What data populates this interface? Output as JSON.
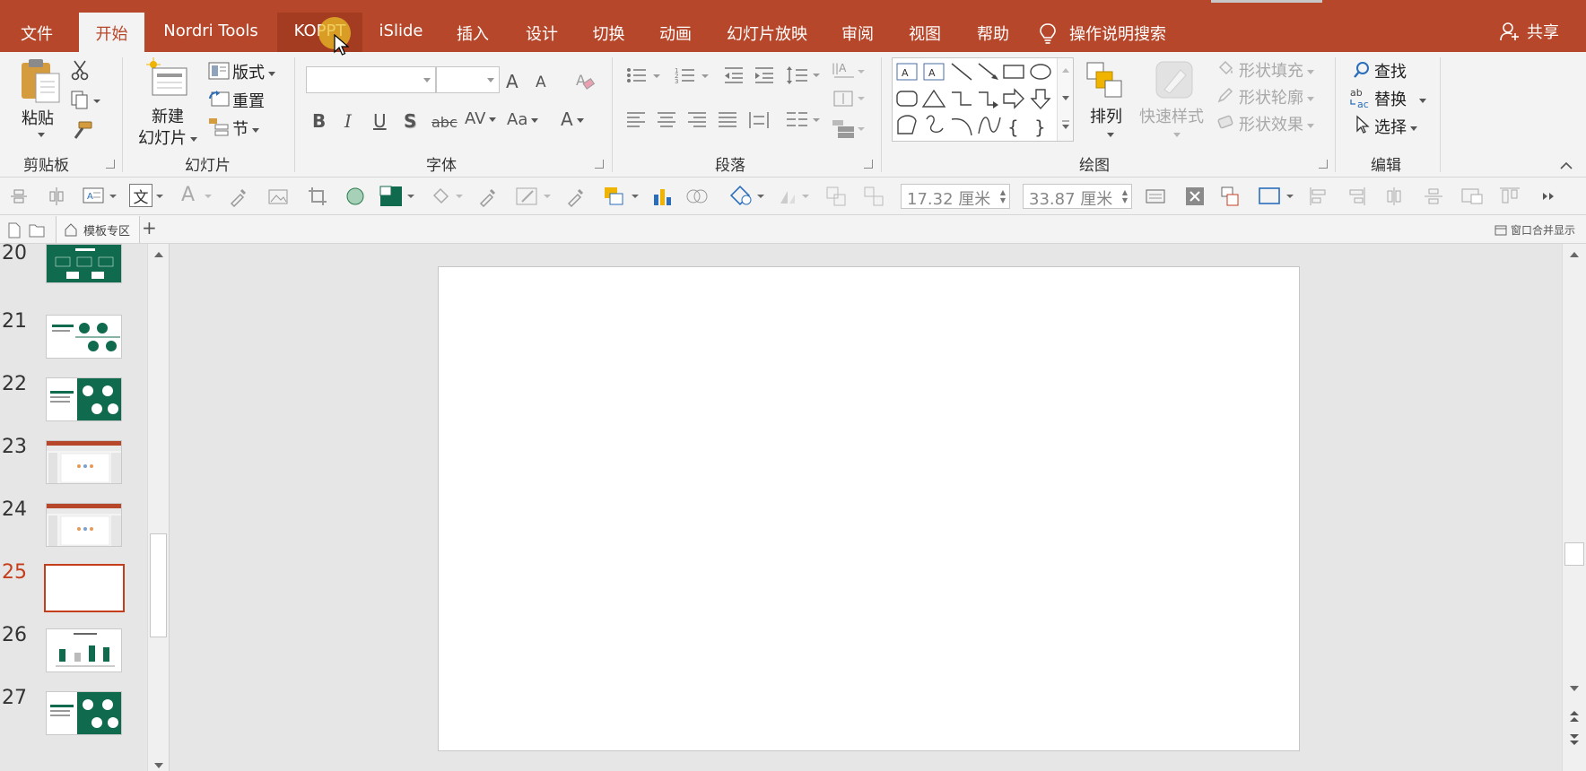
{
  "tabs": {
    "file": "文件",
    "home": "开始",
    "nordri": "Nordri Tools",
    "koppt": "KOPPT",
    "islide": "iSlide",
    "insert": "插入",
    "design": "设计",
    "transitions": "切换",
    "animations": "动画",
    "slideshow": "幻灯片放映",
    "review": "审阅",
    "view": "视图",
    "help": "帮助"
  },
  "tell_me": "操作说明搜索",
  "share": "共享",
  "ribbon": {
    "clipboard": {
      "label": "剪贴板",
      "paste": "粘贴"
    },
    "slides": {
      "label": "幻灯片",
      "new_slide_line1": "新建",
      "new_slide_line2": "幻灯片",
      "layout": "版式",
      "reset": "重置",
      "section": "节"
    },
    "font": {
      "label": "字体",
      "bold": "B",
      "italic": "I",
      "underline": "U",
      "shadow": "S",
      "strike": "abc",
      "spacing": "AV",
      "case": "Aa",
      "grow": "A",
      "shrink": "A",
      "color": "A"
    },
    "paragraph": {
      "label": "段落"
    },
    "drawing": {
      "label": "绘图",
      "arrange": "排列",
      "quick_styles": "快速样式",
      "shape_fill": "形状填充",
      "shape_outline": "形状轮廓",
      "shape_effects": "形状效果"
    },
    "editing": {
      "label": "编辑",
      "find": "查找",
      "replace": "替换",
      "select": "选择"
    }
  },
  "quickbar": {
    "height_value": "17.32 厘米",
    "width_value": "33.87 厘米",
    "textbox_letter": "文",
    "font_letter": "A"
  },
  "filestrip": {
    "templates_tab": "模板专区",
    "add_tab": "+",
    "merge_windows": "窗口合并显示"
  },
  "slides": [
    {
      "number": "20",
      "style": "green-full"
    },
    {
      "number": "21",
      "style": "white-green"
    },
    {
      "number": "22",
      "style": "white-green-block"
    },
    {
      "number": "23",
      "style": "screenshot"
    },
    {
      "number": "24",
      "style": "screenshot"
    },
    {
      "number": "25",
      "style": "blank",
      "current": true
    },
    {
      "number": "26",
      "style": "bars"
    },
    {
      "number": "27",
      "style": "white-green-block"
    }
  ],
  "colors": {
    "accent": "#b7472a",
    "current_slide": "#c43e1c",
    "thumb_green": "#106a4e"
  }
}
